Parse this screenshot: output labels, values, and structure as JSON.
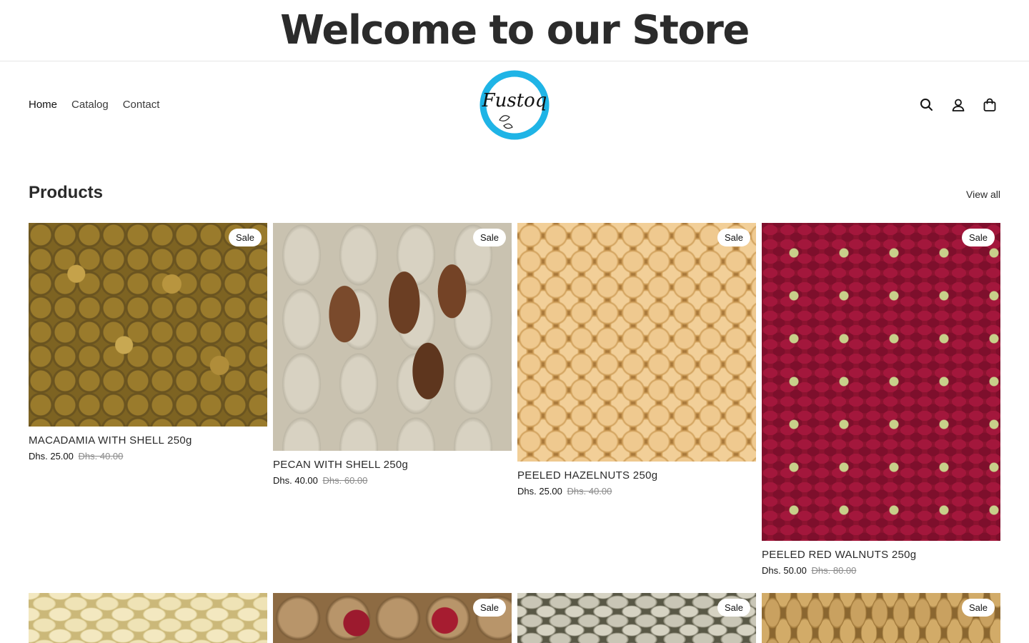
{
  "announcement": {
    "text": "Welcome to our Store"
  },
  "header": {
    "nav": [
      {
        "label": "Home"
      },
      {
        "label": "Catalog"
      },
      {
        "label": "Contact"
      }
    ],
    "logo_text": "Fustoq",
    "icons": [
      "search-icon",
      "account-icon",
      "cart-icon"
    ]
  },
  "products_section": {
    "title": "Products",
    "view_all": "View all",
    "items": [
      {
        "badge": "Sale",
        "title": "MACADAMIA WITH SHELL 250g",
        "price": "Dhs. 25.00",
        "compare_price": "Dhs. 40.00"
      },
      {
        "badge": "Sale",
        "title": "PECAN WITH SHELL 250g",
        "price": "Dhs. 40.00",
        "compare_price": "Dhs. 60.00"
      },
      {
        "badge": "Sale",
        "title": "PEELED HAZELNUTS 250g",
        "price": "Dhs. 25.00",
        "compare_price": "Dhs. 40.00"
      },
      {
        "badge": "Sale",
        "title": "PEELED RED WALNUTS 250g",
        "price": "Dhs. 50.00",
        "compare_price": "Dhs. 80.00"
      },
      {
        "badge": ""
      },
      {
        "badge": "Sale"
      },
      {
        "badge": "Sale"
      },
      {
        "badge": "Sale"
      }
    ]
  },
  "colors": {
    "logo_ring": "#1fb4e6",
    "text": "#121212",
    "strike_price": "#8a8a8a"
  }
}
